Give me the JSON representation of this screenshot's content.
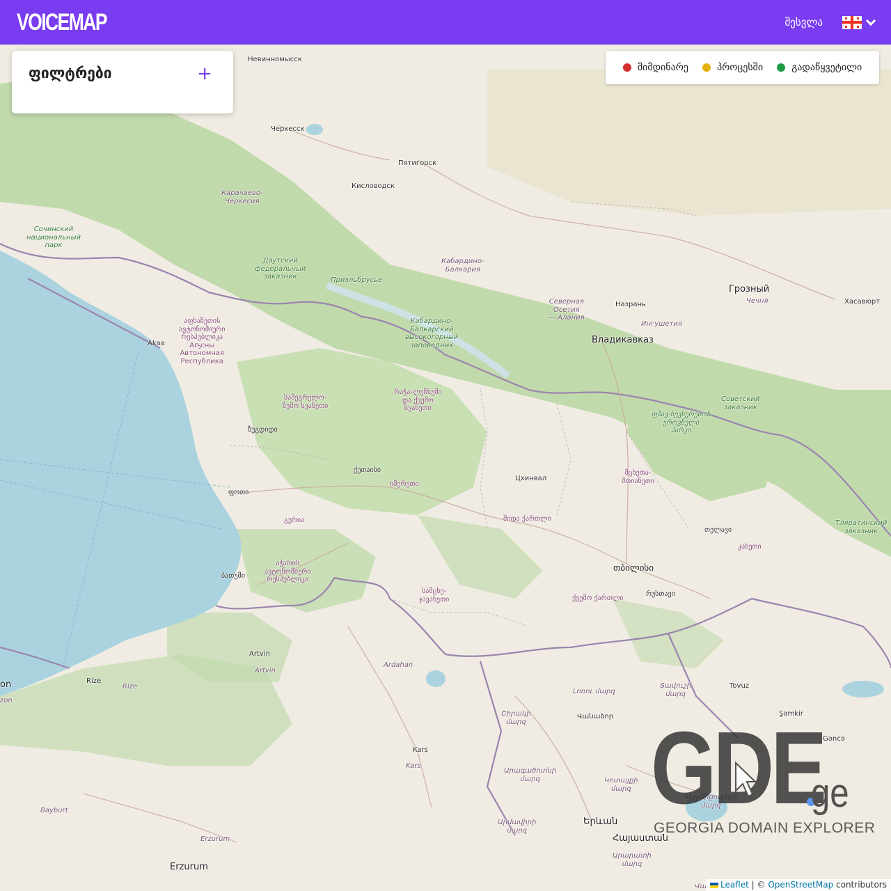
{
  "header": {
    "logo": "VOICEMAP",
    "login_label": "შესვლა",
    "language_icon": "georgian-flag-icon",
    "chevron_icon": "chevron-down-icon"
  },
  "filters": {
    "title": "ფილტრები",
    "add_icon": "plus-icon"
  },
  "legend": {
    "items": [
      {
        "label": "მიმდინარე",
        "color": "#d62f2f"
      },
      {
        "label": "პროცესში",
        "color": "#e6b00c"
      },
      {
        "label": "გადაწყვეტილი",
        "color": "#1f9a46"
      }
    ]
  },
  "map": {
    "labels": [
      {
        "key": "nevinnomyssk",
        "text": "Невинномысск"
      },
      {
        "key": "cherkessk",
        "text": "Черкесск"
      },
      {
        "key": "pyatigorsk",
        "text": "Пятигорск"
      },
      {
        "key": "kislovodsk",
        "text": "Кисловодск"
      },
      {
        "key": "kch",
        "text": "Карачаево-\nЧеркесия"
      },
      {
        "key": "sochi",
        "text": "Сочинский\nнациональный\nпарк"
      },
      {
        "key": "dout",
        "text": "Даутский\nфедеральный\nзаказник"
      },
      {
        "key": "prielbrusye",
        "text": "Приэльбрусье"
      },
      {
        "key": "kbr",
        "text": "Кабардино-\nБалкария"
      },
      {
        "key": "kbzap",
        "text": "Кабардино-\nБалкарский\nвысокогорный\nзаповедник"
      },
      {
        "key": "grozny",
        "text": "Грозный"
      },
      {
        "key": "chechnya",
        "text": "Чечня"
      },
      {
        "key": "khasavyurt",
        "text": "Хасавюрт"
      },
      {
        "key": "nazran",
        "text": "Назрань"
      },
      {
        "key": "sev_osetia",
        "text": "Северная\nОсетия\n— Алания"
      },
      {
        "key": "ingushetia",
        "text": "Ингушетия"
      },
      {
        "key": "vladikavkaz",
        "text": "Владикавказ"
      },
      {
        "key": "abkhazia",
        "text": "აფხაზეთის\nავტონომიური\nრესპუბლიკა\nАҧсны\nАвтономная\nРеспублика"
      },
      {
        "key": "akaa",
        "text": "Akaa"
      },
      {
        "key": "samegrelo",
        "text": "სამეგრელო-\nზემო სვანეთი"
      },
      {
        "key": "racha",
        "text": "რაჭა-ლეჩხუმი\nდა ქვემო\nსვანეთი"
      },
      {
        "key": "sovetsky",
        "text": "Советский\nзаказник"
      },
      {
        "key": "tusheti",
        "text": "ფშავ-ხევსურეთის\nეროვნული\nპარკი"
      },
      {
        "key": "zugdidi",
        "text": "ზუგდიდი"
      },
      {
        "key": "kutaisi",
        "text": "ქუთაისი"
      },
      {
        "key": "imereti",
        "text": "იმერეთი"
      },
      {
        "key": "tskhinval",
        "text": "Цхинвал"
      },
      {
        "key": "mtskheta",
        "text": "მცხეთა-\nმთიანეთი"
      },
      {
        "key": "poti",
        "text": "ფოთი"
      },
      {
        "key": "guria",
        "text": "გურია"
      },
      {
        "key": "shida",
        "text": "შიდა ქართლი"
      },
      {
        "key": "telavi",
        "text": "თელავი"
      },
      {
        "key": "kakheti",
        "text": "კახეთი"
      },
      {
        "key": "tlyarata",
        "text": "Тляратинский\nзаказник"
      },
      {
        "key": "adjara",
        "text": "აჭარის\nავტონომიური\nრესპუბლიკა"
      },
      {
        "key": "batumi",
        "text": "ბათუმი"
      },
      {
        "key": "tbilisi",
        "text": "თბილისი"
      },
      {
        "key": "rustavi",
        "text": "რუსთავი"
      },
      {
        "key": "samtskhe",
        "text": "სამცხე-\nჯავახეთი"
      },
      {
        "key": "kvemo",
        "text": "ქვემო ქართლი"
      },
      {
        "key": "artvin",
        "text": "Artvin"
      },
      {
        "key": "artvin2",
        "text": "Artvin"
      },
      {
        "key": "ardahan",
        "text": "Ardahan"
      },
      {
        "key": "rize",
        "text": "Rize"
      },
      {
        "key": "rize2",
        "text": "Rize"
      },
      {
        "key": "on",
        "text": "on"
      },
      {
        "key": "zon",
        "text": "zon"
      },
      {
        "key": "lori",
        "text": "Լոռու մարզ"
      },
      {
        "key": "tavush",
        "text": "Տավուշի\nմարզ"
      },
      {
        "key": "tovuz",
        "text": "Tovuz"
      },
      {
        "key": "shamkir",
        "text": "Şəmkir"
      },
      {
        "key": "ganca",
        "text": "Gəncə"
      },
      {
        "key": "shirak",
        "text": "Շիրակի\nմարզ"
      },
      {
        "key": "vanadzor",
        "text": "Վանաձոր"
      },
      {
        "key": "kars",
        "text": "Kars"
      },
      {
        "key": "kars2",
        "text": "Kars"
      },
      {
        "key": "aragatsotn",
        "text": "Արագածոտնի\nմարզ"
      },
      {
        "key": "kotayk",
        "text": "Կոտայքի\nմարզ"
      },
      {
        "key": "gegharkunik",
        "text": "Գեղարքունիքի\nմարզ"
      },
      {
        "key": "armavir",
        "text": "Արմավիրի\nմարզ"
      },
      {
        "key": "yerevan",
        "text": "Երևան"
      },
      {
        "key": "hayastan",
        "text": "Հայաստան"
      },
      {
        "key": "ararat",
        "text": "Արարատի\nմարզ"
      },
      {
        "key": "vayots",
        "text": "Վայոց Ձո"
      },
      {
        "key": "bayburt",
        "text": "Bayburt"
      },
      {
        "key": "erzurum_p",
        "text": "Erzurum"
      },
      {
        "key": "erzurum",
        "text": "Erzurum"
      }
    ]
  },
  "watermark": {
    "brand": "GDE",
    "tld": "ge",
    "tagline": "GEORGIA DOMAIN EXPLORER"
  },
  "attribution": {
    "leaflet": "Leaflet",
    "sep": "| ©",
    "osm": "OpenStreetMap",
    "contributors": "contributors"
  }
}
